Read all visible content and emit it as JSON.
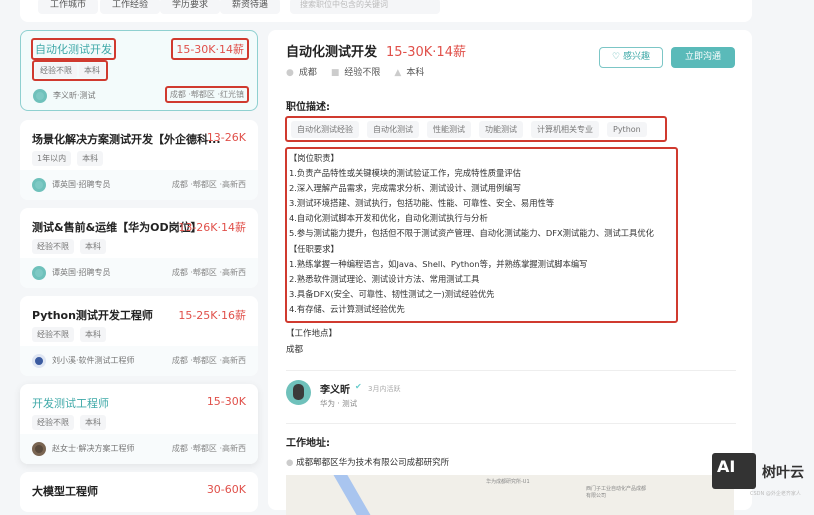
{
  "filters": [
    "工作城市",
    "工作经验",
    "学历要求",
    "薪资待遇"
  ],
  "search_placeholder": "搜索职位中包含的关键词",
  "jobs": [
    {
      "title": "自动化测试开发",
      "salary": "15-30K·14薪",
      "tags": [
        "经验不限",
        "本科"
      ],
      "recruiter": "李义昕·测试",
      "location": "成都 ·郫都区 ·红光镇"
    },
    {
      "title": "场景化解决方案测试开发【外企德科...",
      "salary": "13-26K",
      "tags": [
        "1年以内",
        "本科"
      ],
      "recruiter": "谭英国·招聘专员",
      "location": "成都 ·郫都区 ·高新西"
    },
    {
      "title": "测试&售前&运维【华为OD岗位】",
      "salary": "13-26K·14薪",
      "tags": [
        "经验不限",
        "本科"
      ],
      "recruiter": "谭英国·招聘专员",
      "location": "成都 ·郫都区 ·高新西"
    },
    {
      "title": "Python测试开发工程师",
      "salary": "15-25K·16薪",
      "tags": [
        "经验不限",
        "本科"
      ],
      "recruiter": "刘小溪·软件测试工程师",
      "location": "成都 ·郫都区 ·高新西"
    },
    {
      "title": "开发测试工程师",
      "salary": "15-30K",
      "tags": [
        "经验不限",
        "本科"
      ],
      "recruiter": "赵女士·解决方案工程师",
      "location": "成都 ·郫都区 ·高新西"
    },
    {
      "title": "大模型工程师",
      "salary": "30-60K"
    }
  ],
  "detail": {
    "title": "自动化测试开发",
    "salary": "15-30K·14薪",
    "city": "成都",
    "experience": "经验不限",
    "education": "本科",
    "like_label": "感兴趣",
    "chat_label": "立即沟通",
    "desc_heading": "职位描述:",
    "skills": [
      "自动化测试经验",
      "自动化测试",
      "性能测试",
      "功能测试",
      "计算机相关专业",
      "Python"
    ],
    "desc_lines": [
      "【岗位职责】",
      "1.负责产品特性或关键模块的测试验证工作，完成特性质量评估",
      "2.深入理解产品需求，完成需求分析、测试设计、测试用例编写",
      "3.测试环境搭建、测试执行，包括功能、性能、可靠性、安全、易用性等",
      "4.自动化测试脚本开发和优化，自动化测试执行与分析",
      "5.参与测试能力提升，包括但不限于测试资产管理、自动化测试能力、DFX测试能力、测试工具优化",
      "【任职要求】",
      "1.熟练掌握一种编程语言，如Java、Shell、Python等，并熟练掌握测试脚本编写",
      "2.熟悉软件测试理论、测试设计方法、常用测试工具",
      "3.具备DFX(安全、可靠性、韧性测试之一)测试经验优先",
      "4.有存储、云计算测试经验优先"
    ],
    "workplace_heading": "【工作地点】",
    "workplace": "成都",
    "recruiter_name": "李义昕",
    "recruiter_active": "3月内活跃",
    "recruiter_company": "华为 · 测试",
    "address_heading": "工作地址:",
    "address": "成都郫都区华为技术有限公司成都研究所",
    "map_labels": [
      "华为成都研究所-U1",
      "西门子工业自动化产品成都有限公司"
    ]
  },
  "watermark": {
    "logo": "AI",
    "name": "树叶云",
    "credit": "CSDN @外企老齐家人"
  }
}
